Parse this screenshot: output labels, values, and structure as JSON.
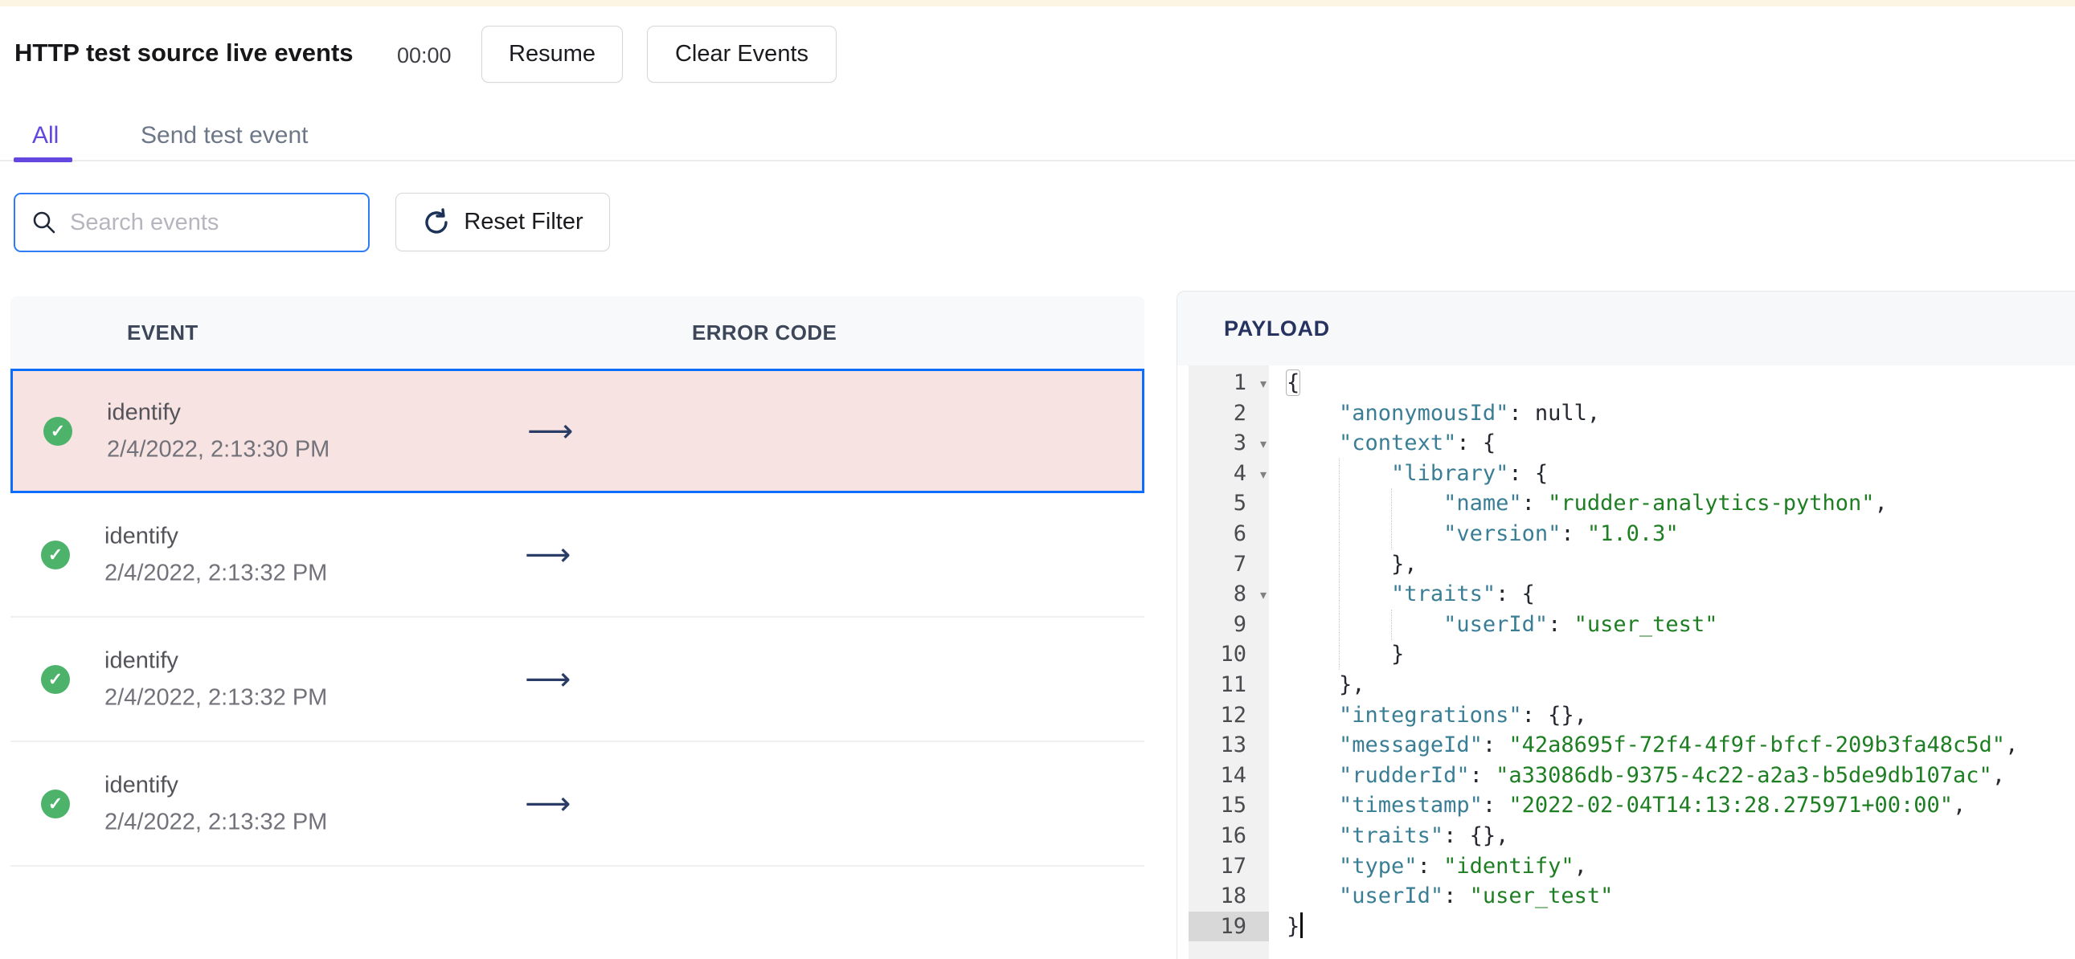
{
  "colors": {
    "purple": "#6347e0",
    "blue": "#0d6efd",
    "row-pink": "#f8e3e3",
    "green": "#4db36b",
    "cream": "#fcf5e3",
    "navy": "#26325f",
    "key-teal": "#3a7e95",
    "string-green": "#1e7e22"
  },
  "header": {
    "title": "HTTP test source live events",
    "timer": "00:00",
    "resume_label": "Resume",
    "clear_events_label": "Clear Events"
  },
  "tabs": {
    "all": "All",
    "send_test_event": "Send test event"
  },
  "filters": {
    "search_placeholder": "Search events",
    "search_value": "",
    "reset_filter_label": "Reset Filter"
  },
  "events_table": {
    "event_column": "EVENT",
    "error_code_column": "ERROR CODE",
    "check_glyph": "✓",
    "arrow_glyph": "⟶",
    "rows": [
      {
        "name": "identify",
        "timestamp": "2/4/2022, 2:13:30 PM",
        "status": "success",
        "selected": true
      },
      {
        "name": "identify",
        "timestamp": "2/4/2022, 2:13:32 PM",
        "status": "success",
        "selected": false
      },
      {
        "name": "identify",
        "timestamp": "2/4/2022, 2:13:32 PM",
        "status": "success",
        "selected": false
      },
      {
        "name": "identify",
        "timestamp": "2/4/2022, 2:13:32 PM",
        "status": "success",
        "selected": false
      }
    ]
  },
  "payload_panel": {
    "title": "PAYLOAD",
    "lines": [
      {
        "n": 1,
        "fold": true,
        "box": true,
        "segs": [
          [
            "p",
            "{"
          ]
        ]
      },
      {
        "n": 2,
        "segs": [
          [
            "w",
            "    "
          ],
          [
            "k",
            "\"anonymousId\""
          ],
          [
            "p",
            ": "
          ],
          [
            "u",
            "null"
          ],
          [
            "p",
            ","
          ]
        ]
      },
      {
        "n": 3,
        "fold": true,
        "segs": [
          [
            "w",
            "    "
          ],
          [
            "k",
            "\"context\""
          ],
          [
            "p",
            ": {"
          ]
        ]
      },
      {
        "n": 4,
        "fold": true,
        "segs": [
          [
            "w",
            "        "
          ],
          [
            "k",
            "\"library\""
          ],
          [
            "p",
            ": {"
          ]
        ]
      },
      {
        "n": 5,
        "segs": [
          [
            "w",
            "            "
          ],
          [
            "k",
            "\"name\""
          ],
          [
            "p",
            ": "
          ],
          [
            "s",
            "\"rudder-analytics-python\""
          ],
          [
            "p",
            ","
          ]
        ]
      },
      {
        "n": 6,
        "segs": [
          [
            "w",
            "            "
          ],
          [
            "k",
            "\"version\""
          ],
          [
            "p",
            ": "
          ],
          [
            "s",
            "\"1.0.3\""
          ]
        ]
      },
      {
        "n": 7,
        "segs": [
          [
            "w",
            "        "
          ],
          [
            "p",
            "},"
          ]
        ]
      },
      {
        "n": 8,
        "fold": true,
        "segs": [
          [
            "w",
            "        "
          ],
          [
            "k",
            "\"traits\""
          ],
          [
            "p",
            ": {"
          ]
        ]
      },
      {
        "n": 9,
        "segs": [
          [
            "w",
            "            "
          ],
          [
            "k",
            "\"userId\""
          ],
          [
            "p",
            ": "
          ],
          [
            "s",
            "\"user_test\""
          ]
        ]
      },
      {
        "n": 10,
        "segs": [
          [
            "w",
            "        "
          ],
          [
            "p",
            "}"
          ]
        ]
      },
      {
        "n": 11,
        "segs": [
          [
            "w",
            "    "
          ],
          [
            "p",
            "},"
          ]
        ]
      },
      {
        "n": 12,
        "segs": [
          [
            "w",
            "    "
          ],
          [
            "k",
            "\"integrations\""
          ],
          [
            "p",
            ": {},"
          ]
        ]
      },
      {
        "n": 13,
        "segs": [
          [
            "w",
            "    "
          ],
          [
            "k",
            "\"messageId\""
          ],
          [
            "p",
            ": "
          ],
          [
            "s",
            "\"42a8695f-72f4-4f9f-bfcf-209b3fa48c5d\""
          ],
          [
            "p",
            ","
          ]
        ]
      },
      {
        "n": 14,
        "segs": [
          [
            "w",
            "    "
          ],
          [
            "k",
            "\"rudderId\""
          ],
          [
            "p",
            ": "
          ],
          [
            "s",
            "\"a33086db-9375-4c22-a2a3-b5de9db107ac\""
          ],
          [
            "p",
            ","
          ]
        ]
      },
      {
        "n": 15,
        "segs": [
          [
            "w",
            "    "
          ],
          [
            "k",
            "\"timestamp\""
          ],
          [
            "p",
            ": "
          ],
          [
            "s",
            "\"2022-02-04T14:13:28.275971+00:00\""
          ],
          [
            "p",
            ","
          ]
        ]
      },
      {
        "n": 16,
        "segs": [
          [
            "w",
            "    "
          ],
          [
            "k",
            "\"traits\""
          ],
          [
            "p",
            ": {},"
          ]
        ]
      },
      {
        "n": 17,
        "segs": [
          [
            "w",
            "    "
          ],
          [
            "k",
            "\"type\""
          ],
          [
            "p",
            ": "
          ],
          [
            "s",
            "\"identify\""
          ],
          [
            "p",
            ","
          ]
        ]
      },
      {
        "n": 18,
        "segs": [
          [
            "w",
            "    "
          ],
          [
            "k",
            "\"userId\""
          ],
          [
            "p",
            ": "
          ],
          [
            "s",
            "\"user_test\""
          ]
        ]
      },
      {
        "n": 19,
        "active": true,
        "cursor": true,
        "segs": [
          [
            "p",
            "}"
          ]
        ]
      }
    ]
  }
}
